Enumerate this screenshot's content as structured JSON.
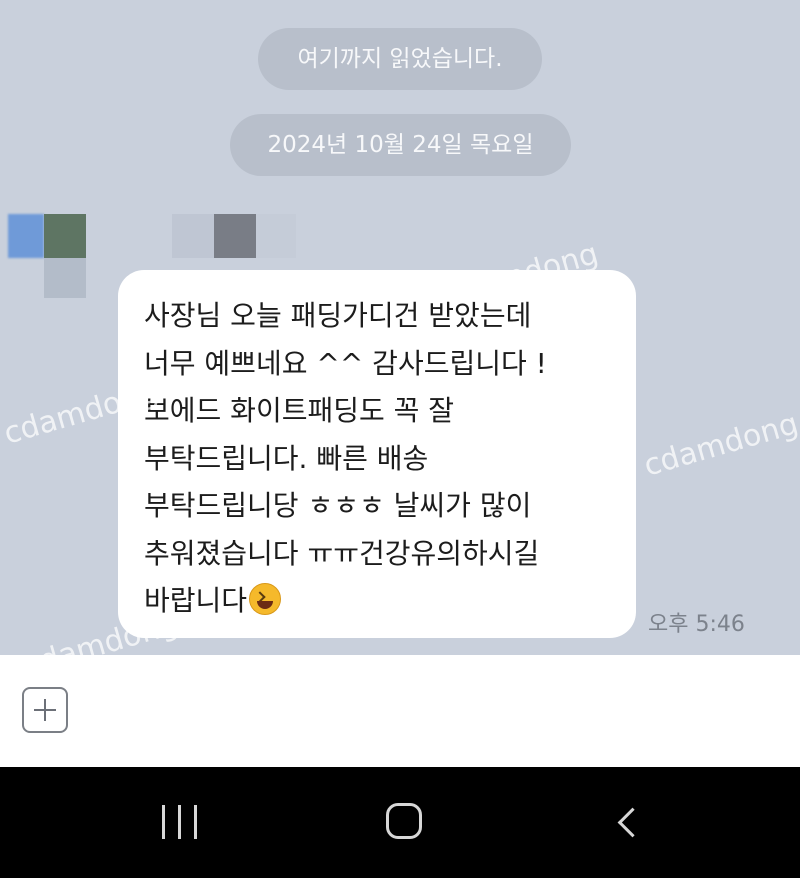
{
  "chat": {
    "read_marker": "여기까지 읽었습니다.",
    "date_divider": "2024년 10월 24일 목요일",
    "message": {
      "lines": [
        "사장님 오늘 패딩가디건 받았는데",
        "너무 예쁘네요 ^^ 감사드립니다 !",
        "보에드 화이트패딩도 꼭 잘",
        "부탁드립니다.  빠른 배송",
        "부탁드립니당 ㅎㅎㅎ 날씨가 많이",
        "추워졌습니다 ㅠㅠ건강유의하시길",
        "바랍니다"
      ],
      "emoji": "grinning-squinting-face",
      "time": "오후 5:46"
    },
    "watermark": "cdamdong"
  },
  "input_bar": {
    "add_icon": "plus-box-icon"
  },
  "nav_bar": {
    "recents_icon": "recents-icon",
    "home_icon": "home-icon",
    "back_icon": "back-icon"
  },
  "colors": {
    "chat_background": "#c9d0dc",
    "bubble": "#ffffff",
    "pill": "#b8bfcb",
    "nav_background": "#000000"
  }
}
